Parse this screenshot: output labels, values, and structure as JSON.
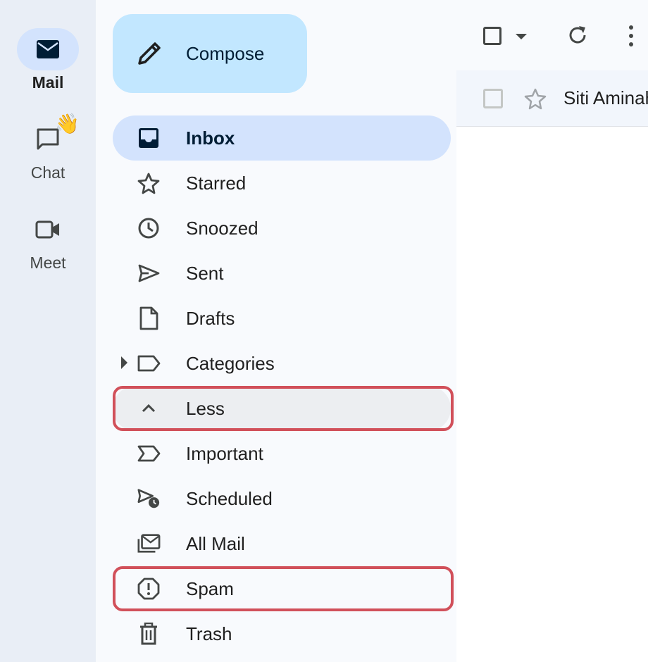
{
  "rail": {
    "items": [
      {
        "label": "Mail",
        "icon": "mail-icon",
        "active": true
      },
      {
        "label": "Chat",
        "icon": "chat-icon",
        "badge": "👋"
      },
      {
        "label": "Meet",
        "icon": "video-icon"
      }
    ]
  },
  "compose": {
    "label": "Compose",
    "icon": "pencil-icon"
  },
  "nav": {
    "items": [
      {
        "label": "Inbox",
        "icon": "inbox-icon",
        "active": true
      },
      {
        "label": "Starred",
        "icon": "star-icon"
      },
      {
        "label": "Snoozed",
        "icon": "clock-icon"
      },
      {
        "label": "Sent",
        "icon": "send-icon"
      },
      {
        "label": "Drafts",
        "icon": "draft-icon"
      },
      {
        "label": "Categories",
        "icon": "label-icon"
      },
      {
        "label": "Less",
        "icon": "chevron-up-icon"
      },
      {
        "label": "Important",
        "icon": "important-icon"
      },
      {
        "label": "Scheduled",
        "icon": "scheduled-icon"
      },
      {
        "label": "All Mail",
        "icon": "all-mail-icon"
      },
      {
        "label": "Spam",
        "icon": "spam-icon"
      },
      {
        "label": "Trash",
        "icon": "trash-icon"
      }
    ]
  },
  "message_list": {
    "rows": [
      {
        "sender": "Siti Aminah"
      }
    ]
  },
  "colors": {
    "rail_bg": "#e9eef6",
    "active_bg": "#d3e3fd",
    "compose_bg": "#c2e7ff",
    "highlight": "#d1505a"
  }
}
